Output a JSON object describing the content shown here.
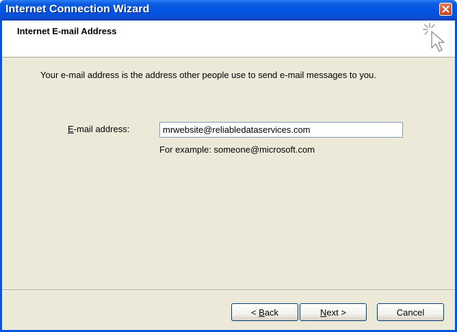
{
  "window": {
    "title": "Internet Connection Wizard"
  },
  "header": {
    "title": "Internet E-mail Address",
    "icon": "wizard-cursor-sparkle-icon"
  },
  "content": {
    "intro": "Your e-mail address is the address other people use to send e-mail messages to you.",
    "email_label_prefix": "E",
    "email_label_rest": "-mail address:",
    "email_value": "mrwebsite@reliabledataservices.com",
    "example": "For example: someone@microsoft.com"
  },
  "buttons": {
    "back_prefix": "< ",
    "back_mnemonic": "B",
    "back_rest": "ack",
    "next_mnemonic": "N",
    "next_rest": "ext >",
    "cancel": "Cancel"
  },
  "colors": {
    "titlebar": "#0054e3",
    "client_bg": "#ece9d8",
    "close_button": "#c83f14"
  }
}
